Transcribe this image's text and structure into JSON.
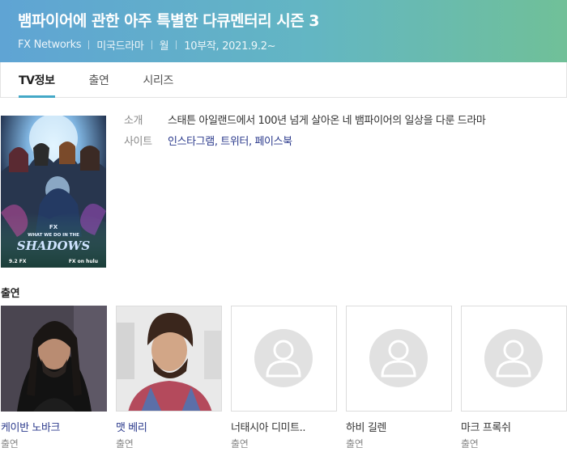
{
  "header": {
    "title": "뱀파이어에 관한 아주 특별한 다큐멘터리 시즌 3",
    "meta": [
      "FX Networks",
      "미국드라마",
      "월",
      "10부작, 2021.9.2~"
    ]
  },
  "tabs": [
    {
      "label": "TV정보",
      "active": true
    },
    {
      "label": "출연",
      "active": false
    },
    {
      "label": "시리즈",
      "active": false
    }
  ],
  "info": {
    "intro_label": "소개",
    "intro_text": "스태튼 아일랜드에서 100년 넘게 살아온 네 뱀파이어의 일상을 다룬 드라마",
    "site_label": "사이트",
    "sites": [
      "인스타그램",
      "트위터",
      "페이스북"
    ]
  },
  "poster": {
    "title_line1": "WHAT WE DO IN THE",
    "title_line2": "SHADOWS",
    "fx_mark": "FX",
    "bottom_date": "9.2 FX",
    "bottom_right": "FX on hulu"
  },
  "cast": {
    "heading": "출연",
    "members": [
      {
        "name": "케이반 노바크",
        "role": "출연",
        "has_photo": true,
        "linked": true
      },
      {
        "name": "맷 베리",
        "role": "출연",
        "has_photo": true,
        "linked": true
      },
      {
        "name": "너태시아 디미트..",
        "role": "출연",
        "has_photo": false,
        "linked": false
      },
      {
        "name": "하비 길렌",
        "role": "출연",
        "has_photo": false,
        "linked": false
      },
      {
        "name": "마크 프록쉬",
        "role": "출연",
        "has_photo": false,
        "linked": false
      }
    ]
  },
  "colors": {
    "accent": "#44a8c7",
    "link": "#2b3a8c"
  }
}
